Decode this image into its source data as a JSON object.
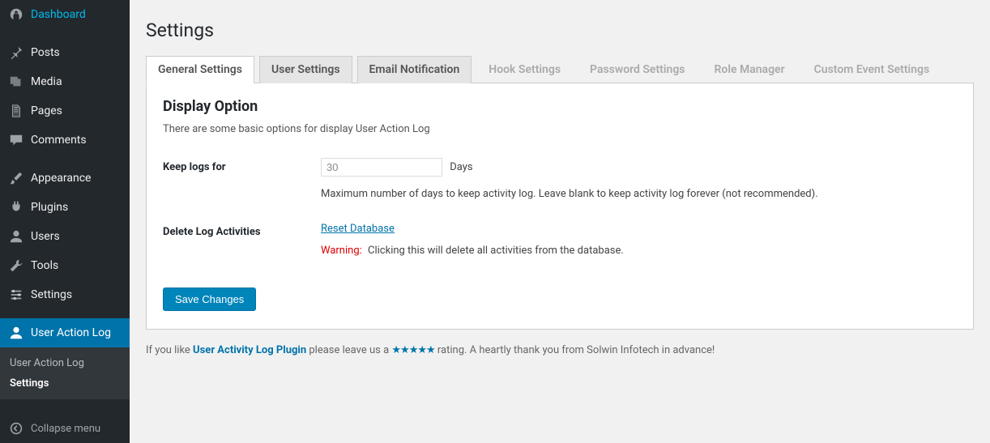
{
  "sidebar": {
    "items": [
      {
        "label": "Dashboard",
        "icon": "dashboard-icon"
      },
      {
        "label": "Posts",
        "icon": "pin-icon"
      },
      {
        "label": "Media",
        "icon": "media-icon"
      },
      {
        "label": "Pages",
        "icon": "pages-icon"
      },
      {
        "label": "Comments",
        "icon": "comments-icon"
      },
      {
        "label": "Appearance",
        "icon": "brush-icon"
      },
      {
        "label": "Plugins",
        "icon": "plug-icon"
      },
      {
        "label": "Users",
        "icon": "users-icon"
      },
      {
        "label": "Tools",
        "icon": "wrench-icon"
      },
      {
        "label": "Settings",
        "icon": "sliders-icon"
      },
      {
        "label": "User Action Log",
        "icon": "user-icon"
      }
    ],
    "submenu": [
      {
        "label": "User Action Log"
      },
      {
        "label": "Settings"
      }
    ],
    "collapse_label": "Collapse menu"
  },
  "page": {
    "title": "Settings"
  },
  "tabs": [
    {
      "label": "General Settings",
      "state": "active"
    },
    {
      "label": "User Settings",
      "state": "normal"
    },
    {
      "label": "Email Notification",
      "state": "normal"
    },
    {
      "label": "Hook Settings",
      "state": "disabled"
    },
    {
      "label": "Password Settings",
      "state": "disabled"
    },
    {
      "label": "Role Manager",
      "state": "disabled"
    },
    {
      "label": "Custom Event Settings",
      "state": "disabled"
    }
  ],
  "section": {
    "title": "Display Option",
    "description": "There are some basic options for display User Action Log"
  },
  "form": {
    "keep_logs_label": "Keep logs for",
    "keep_logs_value": "30",
    "keep_logs_unit": "Days",
    "keep_logs_help": "Maximum number of days to keep activity log. Leave blank to keep activity log forever (not recommended).",
    "delete_label": "Delete Log Activities",
    "reset_link": "Reset Database",
    "warning_label": "Warning:",
    "warning_text": "Clicking this will delete all activities from the database.",
    "save_label": "Save Changes"
  },
  "footer": {
    "prefix": "If you like ",
    "plugin_name": "User Activity Log Plugin",
    "mid": " please leave us a ",
    "stars": "★★★★★",
    "suffix": " rating. A heartly thank you from Solwin Infotech in advance!"
  }
}
